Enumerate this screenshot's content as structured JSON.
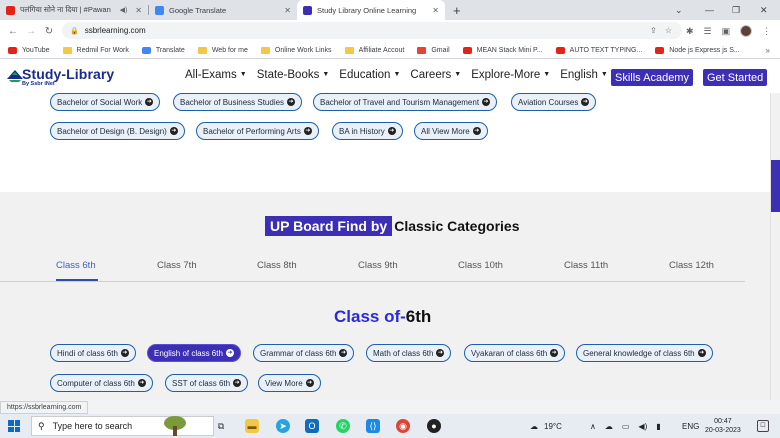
{
  "browser": {
    "tabs": [
      {
        "label": "पलंगिया सोने ना दिया | #Pawan",
        "favicon": "youtube-icon",
        "color": "#e62117",
        "audio": true
      },
      {
        "label": "Google Translate",
        "favicon": "translate-icon",
        "color": "#4285f4",
        "audio": false
      },
      {
        "label": "Study Library Online Learning",
        "favicon": "studylibrary-icon",
        "color": "#3d2fb5",
        "audio": false
      }
    ],
    "new_tab_glyph": "+",
    "window_controls": [
      "⌄",
      "—",
      "❐",
      "✕"
    ],
    "url": "ssbrlearning.com",
    "bookmarks": [
      {
        "label": "YouTube",
        "icon": "yt"
      },
      {
        "label": "Redmil For Work",
        "icon": "folder"
      },
      {
        "label": "Translate",
        "icon": "gt"
      },
      {
        "label": "Web for me",
        "icon": "folder"
      },
      {
        "label": "Online Work Links",
        "icon": "folder"
      },
      {
        "label": "Affiliate Accout",
        "icon": "folder"
      },
      {
        "label": "Gmail",
        "icon": "gm"
      },
      {
        "label": "MEAN Stack Mini P...",
        "icon": "yt"
      },
      {
        "label": "AUTO TEXT TYPING...",
        "icon": "yt"
      },
      {
        "label": "Node js Express js S...",
        "icon": "yt"
      }
    ],
    "bookmarks_more": "»",
    "status_url": "https://ssbrlearning.com"
  },
  "site": {
    "logo": {
      "study": "Study",
      "dash": "-",
      "library": "Library",
      "tagline": "By Ssbr iNet"
    },
    "nav": [
      "All-Exams",
      "State-Books",
      "Education",
      "Careers",
      "Explore-More",
      "English"
    ],
    "skills_button": "Skills Academy",
    "start_button": "Get Started"
  },
  "courses_row1": [
    "Bachelor of Social Work",
    "Bachelor of Business Studies",
    "Bachelor of Travel and Tourism Management",
    "Aviation Courses"
  ],
  "courses_row2": [
    "Bachelor of Design (B. Design)",
    "Bachelor of Performing Arts",
    "BA in History",
    "All View More"
  ],
  "find_section": {
    "highlight": "UP Board Find by",
    "rest": "Classic Categories",
    "class_tabs": [
      "Class 6th",
      "Class 7th",
      "Class 8th",
      "Class 9th",
      "Class 10th",
      "Class 11th",
      "Class 12th"
    ],
    "active_tab": "Class 6th",
    "heading_prefix": "Class of-",
    "heading_number": "6th",
    "subjects_row1": [
      "Hindi of class 6th",
      "English of class 6th",
      "Grammar of class 6th",
      "Math of class 6th",
      "Vyakaran of class 6th",
      "General knowledge of class 6th"
    ],
    "subjects_row2": [
      "Computer of class 6th",
      "SST of class 6th",
      "View More"
    ],
    "active_subject": "English of class 6th"
  },
  "taskbar": {
    "search_placeholder": "Type here to search",
    "weather": "19°C",
    "language": "ENG",
    "time": "00:47",
    "date": "20-03-2023"
  },
  "colors": {
    "accent": "#3d2fb5",
    "pill_border": "#1f5fa8",
    "link_blue": "#2b2bd6"
  }
}
